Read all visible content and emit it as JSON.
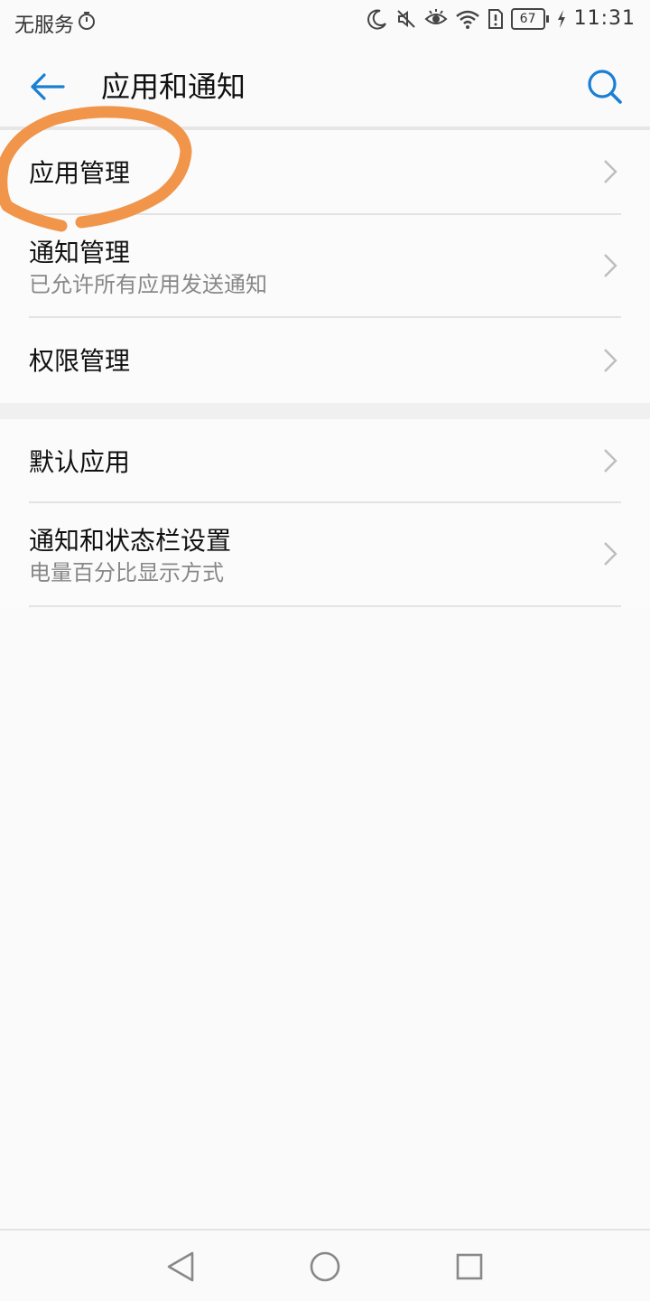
{
  "status_bar": {
    "carrier": "无服务",
    "battery": "67",
    "time": "11:31",
    "icons": [
      "stopwatch-icon",
      "moon-icon",
      "mute-icon",
      "eye-icon",
      "wifi-icon",
      "sim-alert-icon",
      "battery-icon",
      "charging-icon"
    ]
  },
  "header": {
    "title": "应用和通知",
    "back_icon": "arrow-left-icon",
    "search_icon": "search-icon",
    "accent_color": "#1a7fd4"
  },
  "groups": [
    {
      "items": [
        {
          "title": "应用管理",
          "subtitle": ""
        },
        {
          "title": "通知管理",
          "subtitle": "已允许所有应用发送通知"
        },
        {
          "title": "权限管理",
          "subtitle": ""
        }
      ]
    },
    {
      "items": [
        {
          "title": "默认应用",
          "subtitle": ""
        },
        {
          "title": "通知和状态栏设置",
          "subtitle": "电量百分比显示方式"
        }
      ]
    }
  ],
  "annotation_color": "#f0954a",
  "nav_bar": {
    "icons": [
      "nav-back-icon",
      "nav-home-icon",
      "nav-recent-icon"
    ]
  }
}
